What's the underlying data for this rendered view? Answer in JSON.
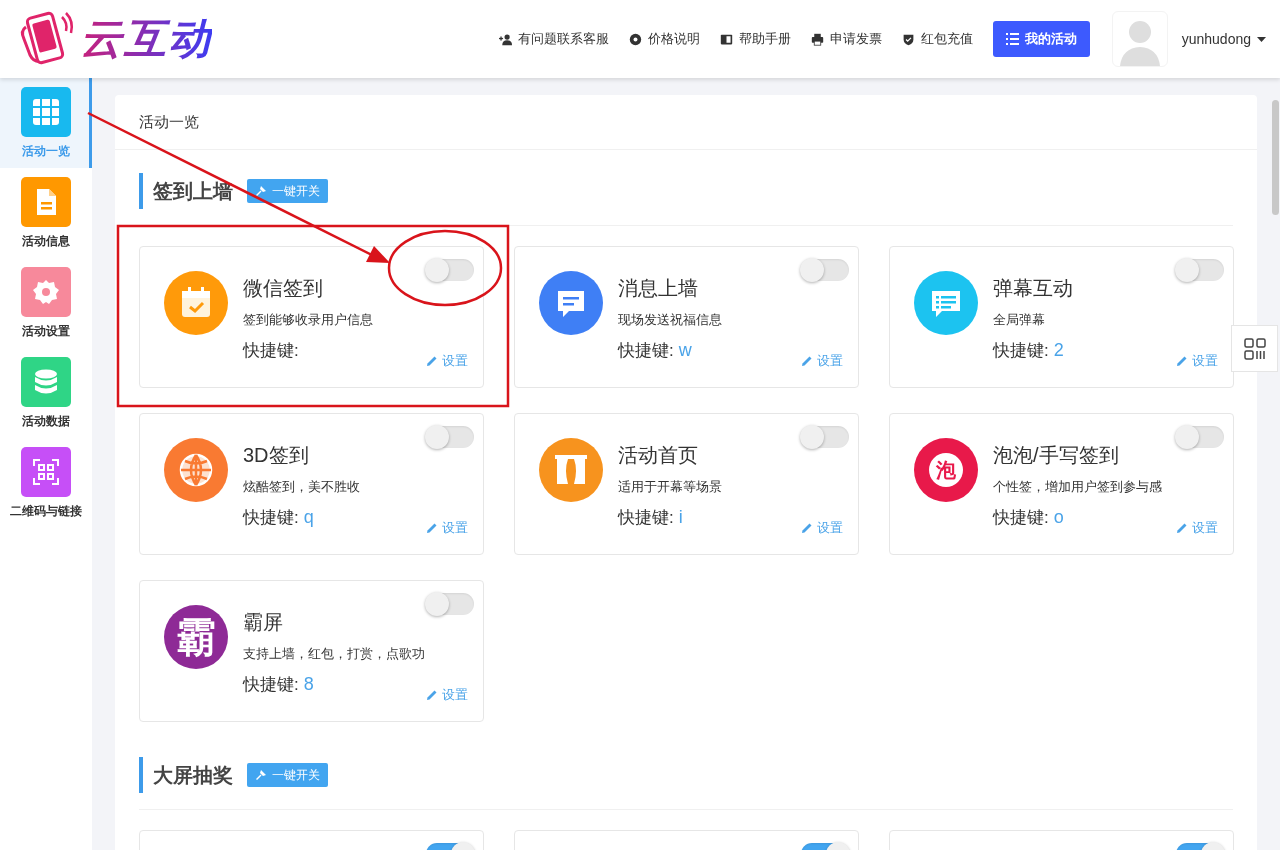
{
  "header": {
    "logo_text": "云互动",
    "nav": [
      {
        "label": "有问题联系客服"
      },
      {
        "label": "价格说明"
      },
      {
        "label": "帮助手册"
      },
      {
        "label": "申请发票"
      },
      {
        "label": "红包充值"
      }
    ],
    "primary_button": "我的活动",
    "username": "yunhudong"
  },
  "sidebar": {
    "items": [
      {
        "label": "活动一览",
        "selected": true,
        "color": "#18b9ef"
      },
      {
        "label": "活动信息",
        "selected": false,
        "color": "#ff9800"
      },
      {
        "label": "活动设置",
        "selected": false,
        "color": "#f7899b"
      },
      {
        "label": "活动数据",
        "selected": false,
        "color": "#2fd586"
      },
      {
        "label": "二维码与链接",
        "selected": false,
        "color": "#c64ff7"
      }
    ]
  },
  "panel": {
    "title": "活动一览",
    "sections": [
      {
        "title": "签到上墙",
        "toggle_all": "一键开关",
        "cards": [
          {
            "title": "微信签到",
            "description": "签到能够收录用户信息",
            "shortcut_label": "快捷键:",
            "on": false,
            "color": "#ff9a0a",
            "setting": "设置"
          },
          {
            "title": "消息上墙",
            "description": "现场发送祝福信息",
            "shortcut_label": "快捷键:",
            "shortcut": "w",
            "on": false,
            "color": "#3f7ff5",
            "setting": "设置"
          },
          {
            "title": "弹幕互动",
            "description": "全局弹幕",
            "shortcut_label": "快捷键:",
            "shortcut": "2",
            "on": false,
            "color": "#1cc3f0",
            "setting": "设置"
          },
          {
            "title": "3D签到",
            "description": "炫酷签到，美不胜收",
            "shortcut_label": "快捷键:",
            "shortcut": "q",
            "on": false,
            "color": "#f97a32",
            "setting": "设置"
          },
          {
            "title": "活动首页",
            "description": "适用于开幕等场景",
            "shortcut_label": "快捷键:",
            "shortcut": "i",
            "on": false,
            "color": "#f7931e",
            "setting": "设置"
          },
          {
            "title": "泡泡/手写签到",
            "description": "个性签，增加用户签到参与感",
            "shortcut_label": "快捷键:",
            "shortcut": "o",
            "on": false,
            "color": "#e8194a",
            "icon_text": "泡",
            "setting": "设置"
          },
          {
            "title": "霸屏",
            "description": "支持上墙，红包，打赏，点歌功",
            "shortcut_label": "快捷键:",
            "shortcut": "8",
            "on": false,
            "color": "#8e2a96",
            "icon_text": "霸",
            "setting": "设置"
          }
        ]
      },
      {
        "title": "大屏抽奖",
        "toggle_all": "一键开关",
        "cards": [
          {
            "on": true
          },
          {
            "on": true
          },
          {
            "on": true
          }
        ]
      }
    ]
  }
}
